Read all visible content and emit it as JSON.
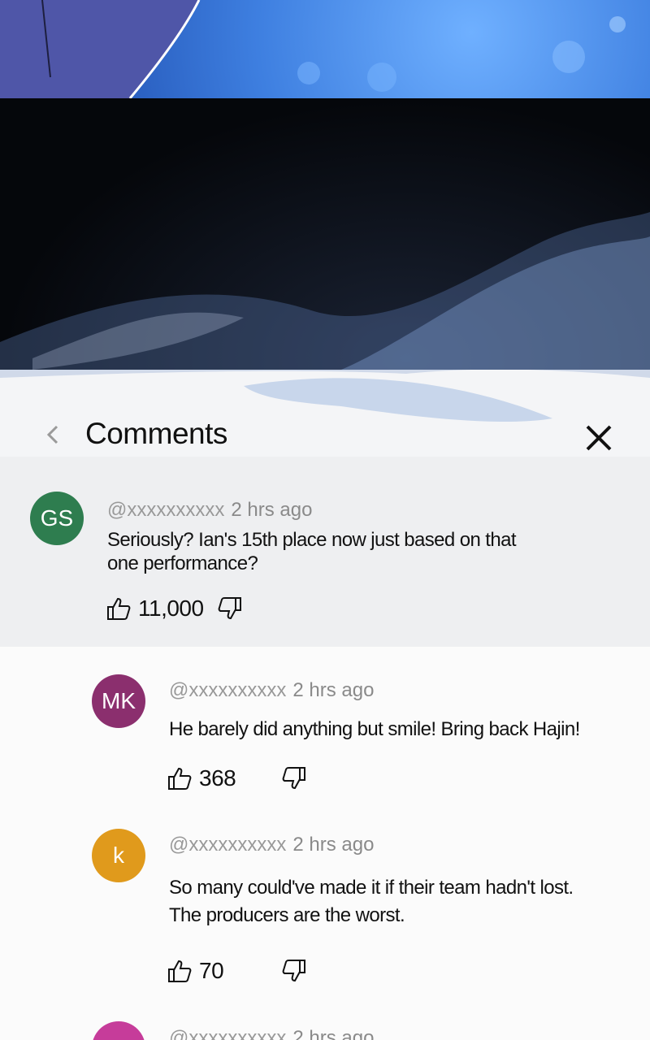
{
  "header": {
    "title": "Comments"
  },
  "comments": [
    {
      "initials": "GS",
      "avatar_color": "#2e7d4f",
      "handle": "@xxxxxxxxxx",
      "time": "2 hrs ago",
      "text_lines": [
        "Seriously? Ian's 15th place now just based on that",
        "one performance?"
      ],
      "likes": "11,000"
    },
    {
      "initials": "MK",
      "avatar_color": "#8b2f6e",
      "handle": "@xxxxxxxxxx",
      "time": "2 hrs ago",
      "text_lines": [
        "He barely did anything but smile! Bring back Hajin!"
      ],
      "likes": "368"
    },
    {
      "initials": "k",
      "avatar_color": "#e09a1c",
      "handle": "@xxxxxxxxxx",
      "time": "2 hrs ago",
      "text_lines": [
        "So many could've made it if their team hadn't lost.",
        "The producers are the worst."
      ],
      "likes": "70"
    },
    {
      "initials": "",
      "avatar_color": "#c63c9a",
      "handle": "@xxxxxxxxxx",
      "time": "2 hrs ago"
    }
  ]
}
